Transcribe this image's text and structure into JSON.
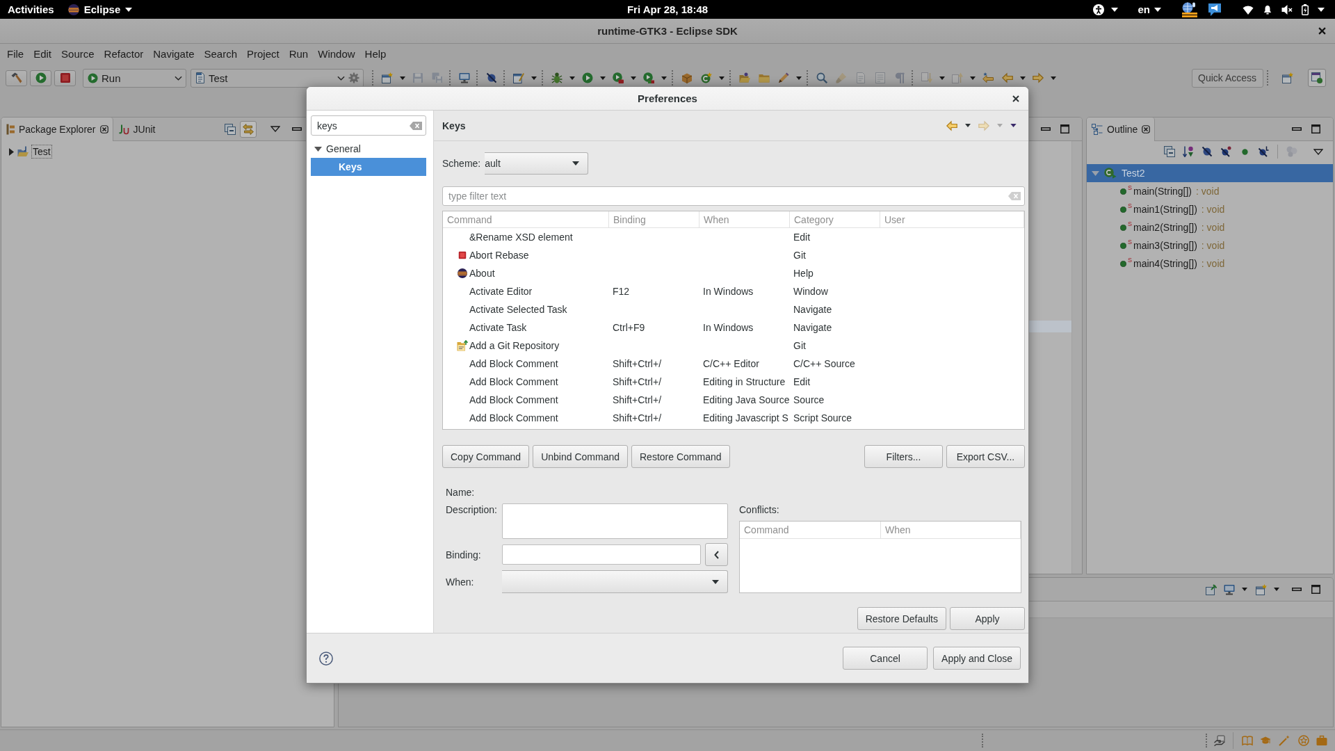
{
  "top_bar": {
    "activities": "Activities",
    "app_menu": "Eclipse",
    "clock": "Fri Apr 28, 18:48",
    "input_source": "en"
  },
  "window": {
    "title": "runtime-GTK3 - Eclipse SDK"
  },
  "menu_bar": [
    "File",
    "Edit",
    "Source",
    "Refactor",
    "Navigate",
    "Search",
    "Project",
    "Run",
    "Window",
    "Help"
  ],
  "toolbar": {
    "launch_buttons": [
      {
        "kind": "build",
        "disabled": false
      },
      {
        "kind": "launch",
        "disabled": false
      },
      {
        "kind": "stop",
        "disabled": false
      }
    ],
    "launch_mode": "Run",
    "launch_configuration": "Test",
    "groups": [
      [
        {
          "kind": "new",
          "disabled": false,
          "menu": true
        },
        {
          "kind": "save",
          "disabled": true,
          "menu": false
        },
        {
          "kind": "save-all",
          "disabled": true,
          "menu": false
        }
      ],
      [
        {
          "kind": "terminal",
          "disabled": false,
          "menu": false
        }
      ],
      [
        {
          "kind": "skip-breakpoints",
          "disabled": false,
          "menu": false
        }
      ],
      [
        {
          "kind": "edit-window",
          "disabled": false,
          "menu": true
        }
      ],
      [
        {
          "kind": "debug",
          "disabled": false,
          "menu": true
        },
        {
          "kind": "run",
          "disabled": false,
          "menu": true
        },
        {
          "kind": "run-external",
          "disabled": false,
          "menu": true
        },
        {
          "kind": "coverage",
          "disabled": false,
          "menu": true
        }
      ],
      [
        {
          "kind": "new-package",
          "disabled": false,
          "menu": false
        },
        {
          "kind": "new-class",
          "disabled": false,
          "menu": true
        }
      ],
      [
        {
          "kind": "open-project",
          "disabled": false,
          "menu": false
        },
        {
          "kind": "open-type",
          "disabled": false,
          "menu": false
        },
        {
          "kind": "marker",
          "disabled": false,
          "menu": true
        }
      ],
      [
        {
          "kind": "search",
          "disabled": false,
          "menu": false
        },
        {
          "kind": "highlight",
          "disabled": true,
          "menu": false
        },
        {
          "kind": "block-select",
          "disabled": true,
          "menu": false
        },
        {
          "kind": "word-wrap",
          "disabled": true,
          "menu": false
        },
        {
          "kind": "whitespace",
          "disabled": true,
          "menu": false
        }
      ],
      [
        {
          "kind": "next-annotation",
          "disabled": true,
          "menu": true
        },
        {
          "kind": "previous-annotation",
          "disabled": true,
          "menu": true
        },
        {
          "kind": "last-edit",
          "disabled": false,
          "menu": false
        },
        {
          "kind": "back",
          "disabled": false,
          "menu": true
        },
        {
          "kind": "forward",
          "disabled": false,
          "menu": true
        }
      ]
    ],
    "quick_access": {
      "placeholder": "Quick Access"
    },
    "perspectives": [
      {
        "kind": "open-perspective",
        "selected": false
      },
      {
        "kind": "java",
        "selected": true
      }
    ]
  },
  "package_explorer": {
    "tabs": [
      {
        "kind": "packages",
        "label": "Package Explorer",
        "selected": true
      },
      {
        "kind": "tests",
        "label": "JUnit",
        "selected": false
      }
    ],
    "link_with_editor": {
      "on": true
    },
    "tree": [
      {
        "label": "Test",
        "expanded": false,
        "selected": false,
        "focused": true
      }
    ]
  },
  "outline": {
    "tabs": [
      {
        "kind": "outline",
        "label": "Outline",
        "selected": true
      }
    ],
    "toolbar": [
      [
        {
          "kind": "collapse-all",
          "disabled": false
        },
        {
          "kind": "sort",
          "disabled": false
        },
        {
          "kind": "hide-fields",
          "disabled": false
        },
        {
          "kind": "hide-static",
          "disabled": false
        },
        {
          "kind": "hide-non-public",
          "disabled": false
        },
        {
          "kind": "hide-local-types",
          "disabled": false
        }
      ],
      [
        {
          "kind": "group",
          "disabled": true
        }
      ]
    ],
    "tree": [
      {
        "label": "Test2",
        "expanded": true,
        "selected": true,
        "children": [
          {
            "modifier": "S",
            "signature": "main(String[])",
            "return_type": ": void",
            "selected": false
          },
          {
            "modifier": "S",
            "signature": "main1(String[])",
            "return_type": ": void",
            "selected": false
          },
          {
            "modifier": "S",
            "signature": "main2(String[])",
            "return_type": ": void",
            "selected": false
          },
          {
            "modifier": "S",
            "signature": "main3(String[])",
            "return_type": ": void",
            "selected": false
          },
          {
            "modifier": "S",
            "signature": "main4(String[])",
            "return_type": ": void",
            "selected": false
          }
        ]
      }
    ]
  },
  "dialog": {
    "title": "Preferences",
    "search": {
      "value": "keys"
    },
    "tree": [
      {
        "label": "General",
        "expanded": true,
        "selected": false,
        "children": [
          {
            "label": "Keys",
            "selected": true
          }
        ]
      }
    ],
    "page_title": "Keys",
    "history": {
      "back": {
        "disabled": false
      },
      "forward": {
        "disabled": true
      }
    },
    "scheme": {
      "label": "Scheme:",
      "value": "ault"
    },
    "filter": {
      "placeholder": "type filter text"
    },
    "bindings": {
      "columns": [
        "Command",
        "Binding",
        "When",
        "Category",
        "User"
      ],
      "rows": [
        {
          "kind": "plain",
          "command": "&Rename XSD element",
          "category": "Edit"
        },
        {
          "kind": "stop",
          "command": "Abort Rebase",
          "category": "Git"
        },
        {
          "kind": "eclipse",
          "command": "About",
          "category": "Help"
        },
        {
          "kind": "plain",
          "command": "Activate Editor",
          "binding": "F12",
          "when": "In Windows",
          "category": "Window"
        },
        {
          "kind": "plain",
          "command": "Activate Selected Task",
          "category": "Navigate"
        },
        {
          "kind": "plain",
          "command": "Activate Task",
          "binding": "Ctrl+F9",
          "when": "In Windows",
          "category": "Navigate"
        },
        {
          "kind": "git",
          "command": "Add a Git Repository",
          "category": "Git"
        },
        {
          "kind": "plain",
          "command": "Add Block Comment",
          "binding": "Shift+Ctrl+/",
          "when": "C/C++ Editor",
          "category": "C/C++ Source"
        },
        {
          "kind": "plain",
          "command": "Add Block Comment",
          "binding": "Shift+Ctrl+/",
          "when": "Editing in Structure",
          "category": "Edit"
        },
        {
          "kind": "plain",
          "command": "Add Block Comment",
          "binding": "Shift+Ctrl+/",
          "when": "Editing Java Source",
          "category": "Source"
        },
        {
          "kind": "plain",
          "command": "Add Block Comment",
          "binding": "Shift+Ctrl+/",
          "when": "Editing Javascript S",
          "category": "Script Source"
        }
      ]
    },
    "command_buttons": [
      {
        "label": "Copy Command"
      },
      {
        "label": "Unbind Command"
      },
      {
        "label": "Restore Command"
      }
    ],
    "table_buttons": [
      {
        "label": "Filters..."
      },
      {
        "label": "Export CSV..."
      }
    ],
    "name": {
      "label": "Name:"
    },
    "description": {
      "label": "Description:"
    },
    "binding": {
      "label": "Binding:"
    },
    "when": {
      "label": "When:"
    },
    "conflicts": {
      "label": "Conflicts:",
      "columns": [
        "Command",
        "When"
      ]
    },
    "page_buttons": [
      {
        "label": "Restore Defaults"
      },
      {
        "label": "Apply"
      }
    ],
    "footer_buttons": [
      {
        "label": "Cancel"
      },
      {
        "label": "Apply and Close"
      }
    ]
  }
}
